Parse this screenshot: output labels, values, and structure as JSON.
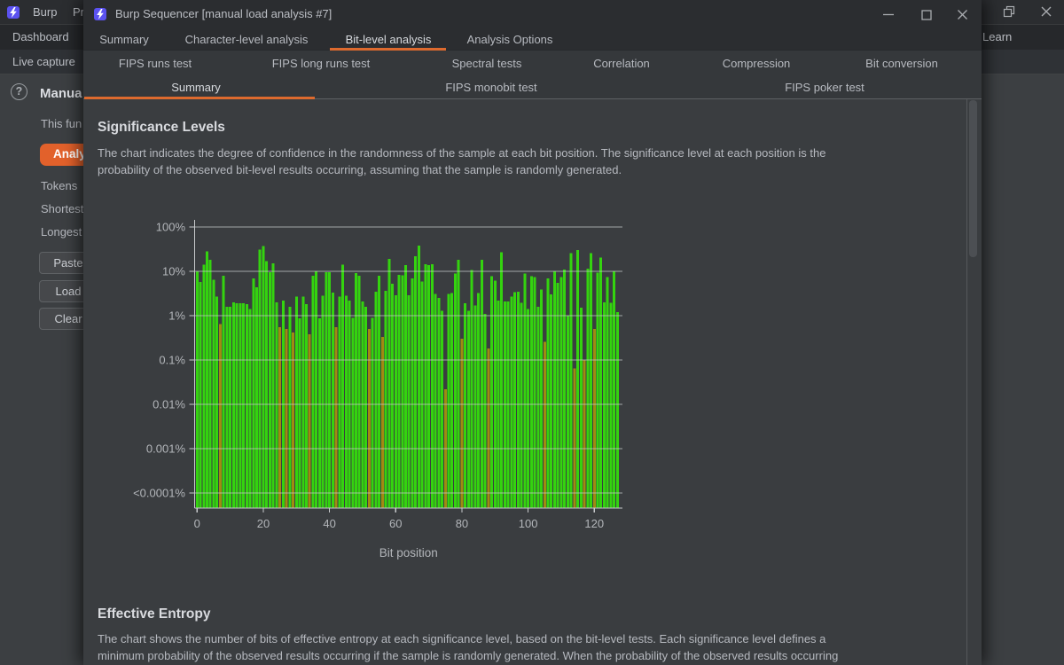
{
  "background_window": {
    "menu_burp": "Burp",
    "menu_project_partial": "Pr",
    "menu_learn": "Learn",
    "tab_dashboard": "Dashboard",
    "subtab_live_capture": "Live capture",
    "panel": {
      "help_icon": "?",
      "heading_partial": "Manua",
      "description_partial": "This fun",
      "analyze_button_partial": "Analyz",
      "stat_tokens": "Tokens",
      "stat_shortest": "Shortest",
      "stat_longest": "Longest",
      "paste_button": "Paste",
      "load_button": "Load",
      "clear_button": "Clear"
    }
  },
  "front_window": {
    "title": "Burp Sequencer [manual load analysis #7]",
    "tabs_level1": [
      {
        "label": "Summary",
        "selected": false
      },
      {
        "label": "Character-level analysis",
        "selected": false
      },
      {
        "label": "Bit-level analysis",
        "selected": true
      },
      {
        "label": "Analysis Options",
        "selected": false
      }
    ],
    "tabs_level2": [
      {
        "label": "FIPS runs test",
        "selected": false
      },
      {
        "label": "FIPS long runs test",
        "selected": false
      },
      {
        "label": "Spectral tests",
        "selected": false
      },
      {
        "label": "Correlation",
        "selected": false
      },
      {
        "label": "Compression",
        "selected": false
      },
      {
        "label": "Bit conversion",
        "selected": false
      }
    ],
    "tabs_level3": [
      {
        "label": "Summary",
        "selected": true
      },
      {
        "label": "FIPS monobit test",
        "selected": false
      },
      {
        "label": "FIPS poker test",
        "selected": false
      }
    ],
    "content": {
      "section1_title": "Significance Levels",
      "section1_lines": [
        "The chart indicates the degree of confidence in the randomness of the sample at each bit position. The significance level at each position is the",
        "probability of the observed bit-level results occurring, assuming that the sample is randomly generated."
      ],
      "section2_title": "Effective Entropy",
      "section2_lines": [
        "The chart shows the number of bits of effective entropy at each significance level, based on the bit-level tests. Each significance level defines a",
        "minimum probability of the observed results occurring if the sample is randomly generated. When the probability of the observed results occurring"
      ]
    }
  },
  "chart_data": {
    "type": "bar",
    "title": "Significance Levels",
    "xlabel": "Bit position",
    "ylabel": "",
    "y_scale": "log",
    "y_tick_labels": [
      "100%",
      "10%",
      "1%",
      "0.1%",
      "0.01%",
      "0.001%",
      "<0.0001%"
    ],
    "y_tick_values": [
      100,
      10,
      1,
      0.1,
      0.01,
      0.001,
      0.0001
    ],
    "x_tick_labels": [
      "0",
      "20",
      "40",
      "60",
      "80",
      "100",
      "120"
    ],
    "x_range": [
      0,
      127
    ],
    "ylim_percent": [
      5e-05,
      100
    ],
    "grid": true,
    "legend": "none",
    "bar_color_green": "#34d30f",
    "bar_color_amber": "#a18a12",
    "values_percent": [
      10,
      5.8,
      14,
      28,
      18,
      6.5,
      2.7,
      0.65,
      7.9,
      1.6,
      1.6,
      2.0,
      1.9,
      1.9,
      1.9,
      1.8,
      1.4,
      7.0,
      4.4,
      31,
      37,
      17,
      9.5,
      15,
      2.0,
      0.55,
      2.2,
      0.5,
      1.6,
      0.42,
      2.7,
      0.87,
      2.7,
      1.8,
      0.38,
      7.9,
      10,
      0.87,
      2.8,
      9.5,
      9.5,
      3.3,
      0.55,
      2.7,
      14,
      2.8,
      2.2,
      0.9,
      9.2,
      7.9,
      2.1,
      1.6,
      0.5,
      0.9,
      3.5,
      7.9,
      0.33,
      3.6,
      19,
      5.2,
      2.9,
      8.4,
      8.1,
      13.8,
      2.9,
      7.0,
      22,
      38,
      5.9,
      14.5,
      13.8,
      14.5,
      3.1,
      2.5,
      1.3,
      0.022,
      3.1,
      3.2,
      8.9,
      18,
      0.3,
      1.9,
      1.3,
      10.8,
      1.7,
      3.2,
      18,
      1.1,
      0.18,
      7.7,
      6.1,
      2.2,
      27,
      2.1,
      2.1,
      2.7,
      3.4,
      3.5,
      1.95,
      8.9,
      1.4,
      7.7,
      7.4,
      1.6,
      3.9,
      0.26,
      7.0,
      3.0,
      10,
      5.5,
      7.4,
      11,
      1.0,
      26,
      0.065,
      30,
      1.5,
      0.1,
      11.6,
      26,
      0.5,
      9.4,
      20.5,
      2.0,
      7.4,
      1.95,
      10,
      1.2
    ],
    "amber_indices": [
      7,
      25,
      27,
      29,
      34,
      42,
      52,
      56,
      75,
      80,
      88,
      105,
      114,
      117,
      120
    ]
  }
}
